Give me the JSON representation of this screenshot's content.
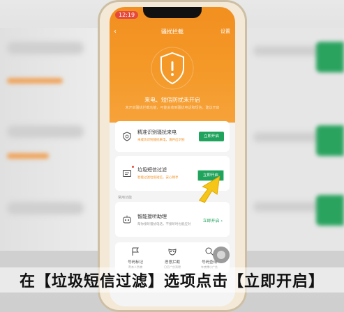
{
  "status_bar": {
    "time": "12:19"
  },
  "header": {
    "back_icon": "chevron-left-icon",
    "title": "骚扰拦截",
    "settings": "设置"
  },
  "hero": {
    "shield_icon": "shield-warning-icon",
    "status": "来电、短信防扰未开启",
    "substatus": "未开启骚扰拦截功能，可能会收到骚扰电话和短信，建议开启"
  },
  "cards": {
    "call": {
      "title": "精准识别骚扰来电",
      "desc": "未成功识别骚扰来电，请开启识别",
      "button": "立即开启"
    },
    "sms": {
      "title": "垃圾短信过滤",
      "desc": "智能过滤垃圾短信，安心畅享",
      "button": "立即开启"
    }
  },
  "common": {
    "label": "常用功能",
    "assistant_title": "智能接听助理",
    "assistant_desc": "帮你接听骚扰电话，不接听时也能应对",
    "assistant_link": "立即开启"
  },
  "tools": [
    {
      "label": "号码标记",
      "sub": "帮亲人防骗",
      "icon": "flag-icon"
    },
    {
      "label": "恶意拦截",
      "sub": "日历广告清理",
      "icon": "mask-icon"
    },
    {
      "label": "号码查询",
      "sub": "年底爆小广告",
      "icon": "phone-search-icon"
    }
  ],
  "caption": "在【垃圾短信过滤】选项点击【立即开启】",
  "colors": {
    "accent": "#f28f1f",
    "button": "#20a35c",
    "arrow": "#f5c518"
  }
}
